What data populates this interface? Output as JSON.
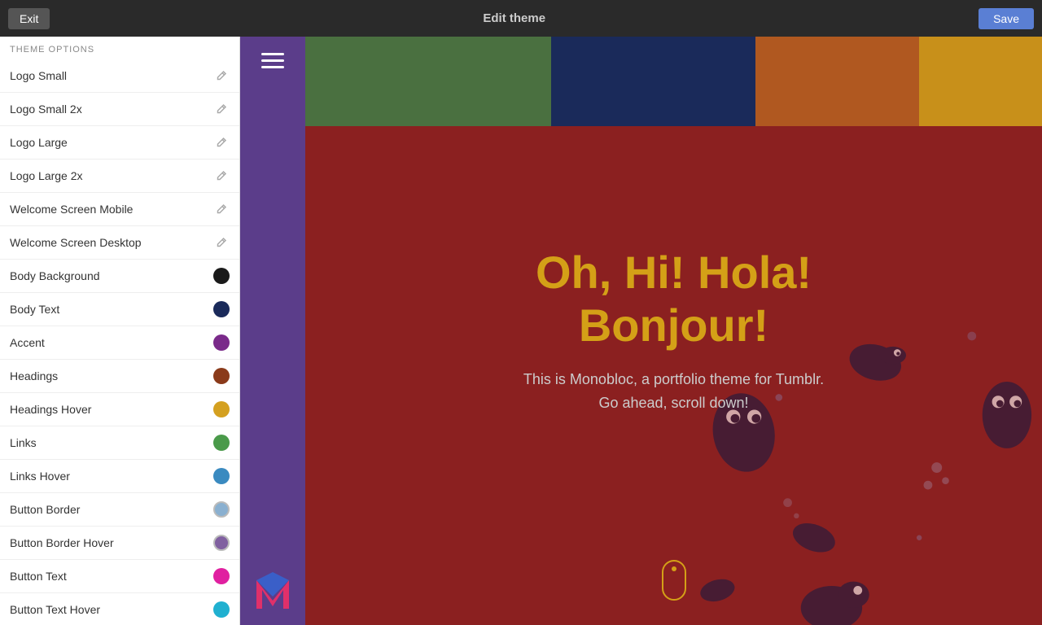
{
  "topbar": {
    "exit_label": "Exit",
    "title": "Edit theme",
    "save_label": "Save"
  },
  "sidebar": {
    "section_label": "THEME OPTIONS",
    "items": [
      {
        "id": "logo-small",
        "label": "Logo Small",
        "type": "edit",
        "color": null
      },
      {
        "id": "logo-small-2x",
        "label": "Logo Small 2x",
        "type": "edit",
        "color": null
      },
      {
        "id": "logo-large",
        "label": "Logo Large",
        "type": "edit",
        "color": null
      },
      {
        "id": "logo-large-2x",
        "label": "Logo Large 2x",
        "type": "edit",
        "color": null
      },
      {
        "id": "welcome-screen-mobile",
        "label": "Welcome Screen Mobile",
        "type": "edit",
        "color": null
      },
      {
        "id": "welcome-screen-desktop",
        "label": "Welcome Screen Desktop",
        "type": "edit",
        "color": null
      },
      {
        "id": "body-background",
        "label": "Body Background",
        "type": "color",
        "color": "#1a1a1a"
      },
      {
        "id": "body-text",
        "label": "Body Text",
        "type": "color",
        "color": "#1a2a5a"
      },
      {
        "id": "accent",
        "label": "Accent",
        "type": "color",
        "color": "#7a2a8a"
      },
      {
        "id": "headings",
        "label": "Headings",
        "type": "color",
        "color": "#8a3a1a"
      },
      {
        "id": "headings-hover",
        "label": "Headings Hover",
        "type": "color",
        "color": "#d4a020"
      },
      {
        "id": "links",
        "label": "Links",
        "type": "color",
        "color": "#4a9a4a"
      },
      {
        "id": "links-hover",
        "label": "Links Hover",
        "type": "color",
        "color": "#3a8ac0"
      },
      {
        "id": "button-border",
        "label": "Button Border",
        "type": "color",
        "color": "#8ab0d0"
      },
      {
        "id": "button-border-hover",
        "label": "Button Border Hover",
        "type": "color",
        "color": "#8060a0"
      },
      {
        "id": "button-text",
        "label": "Button Text",
        "type": "color",
        "color": "#e020a0"
      },
      {
        "id": "button-text-hover",
        "label": "Button Text Hover",
        "type": "color",
        "color": "#20b0d0"
      }
    ]
  },
  "preview": {
    "heading_line1": "Oh, Hi! Hola!",
    "heading_line2": "Bonjour!",
    "subtext_line1": "This is Monobloc, a portfolio theme for Tumblr.",
    "subtext_line2": "Go ahead, scroll down!"
  }
}
